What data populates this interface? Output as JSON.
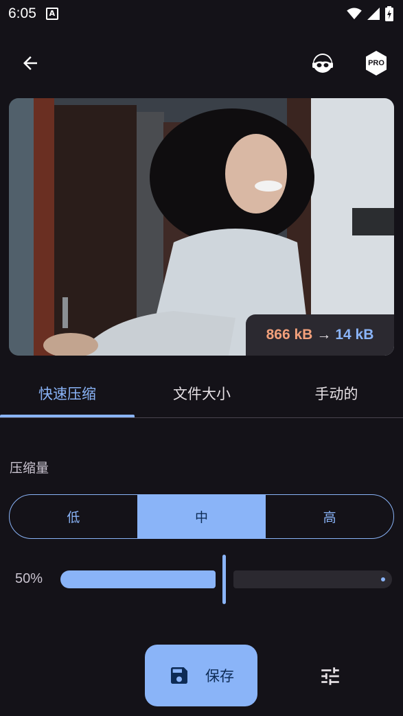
{
  "status_bar": {
    "time": "6:05",
    "notification_icon": "A"
  },
  "app_bar": {
    "back_icon": "arrow-left-icon",
    "mascot_icon": "mascot-icon",
    "pro_label": "PRO"
  },
  "preview": {
    "original_size": "866 kB",
    "arrow": "→",
    "compressed_size": "14 kB"
  },
  "tabs": [
    {
      "label": "快速压缩",
      "active": true
    },
    {
      "label": "文件大小",
      "active": false
    },
    {
      "label": "手动的",
      "active": false
    }
  ],
  "compression": {
    "label": "压缩量",
    "options": [
      {
        "label": "低",
        "selected": false
      },
      {
        "label": "中",
        "selected": true
      },
      {
        "label": "高",
        "selected": false
      }
    ],
    "slider_value_label": "50%",
    "slider_value": 0.5
  },
  "actions": {
    "save_label": "保存",
    "save_icon": "floppy-disk-icon",
    "tune_icon": "tune-sliders-icon"
  },
  "colors": {
    "background": "#141218",
    "accent": "#8ab4f8",
    "original_size": "#f2a07b",
    "surface": "#2b2930"
  }
}
